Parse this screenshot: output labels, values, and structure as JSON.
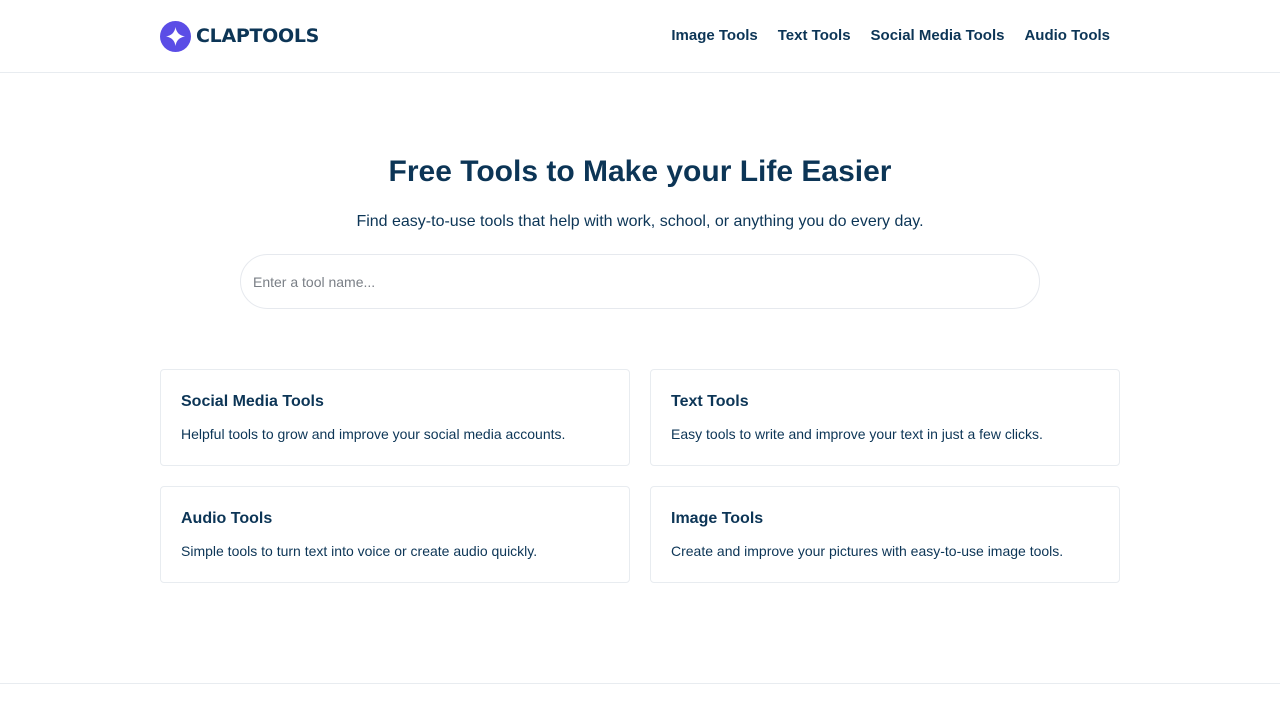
{
  "header": {
    "logo_text": "CLAPTOOLS",
    "logo_icon": "sparkle-star-icon",
    "brand_color": "#5b4de6",
    "nav": [
      {
        "label": "Image Tools"
      },
      {
        "label": "Text Tools"
      },
      {
        "label": "Social Media Tools"
      },
      {
        "label": "Audio Tools"
      }
    ]
  },
  "hero": {
    "title": "Free Tools to Make your Life Easier",
    "subtitle": "Find easy-to-use tools that help with work, school, or anything you do every day."
  },
  "search": {
    "placeholder": "Enter a tool name...",
    "value": ""
  },
  "categories": [
    {
      "title": "Social Media Tools",
      "description": "Helpful tools to grow and improve your social media accounts."
    },
    {
      "title": "Text Tools",
      "description": "Easy tools to write and improve your text in just a few clicks."
    },
    {
      "title": "Audio Tools",
      "description": "Simple tools to turn text into voice or create audio quickly."
    },
    {
      "title": "Image Tools",
      "description": "Create and improve your pictures with easy-to-use image tools."
    }
  ],
  "colors": {
    "text": "#0c3556",
    "border": "#e8ecf0",
    "background": "#ffffff"
  }
}
